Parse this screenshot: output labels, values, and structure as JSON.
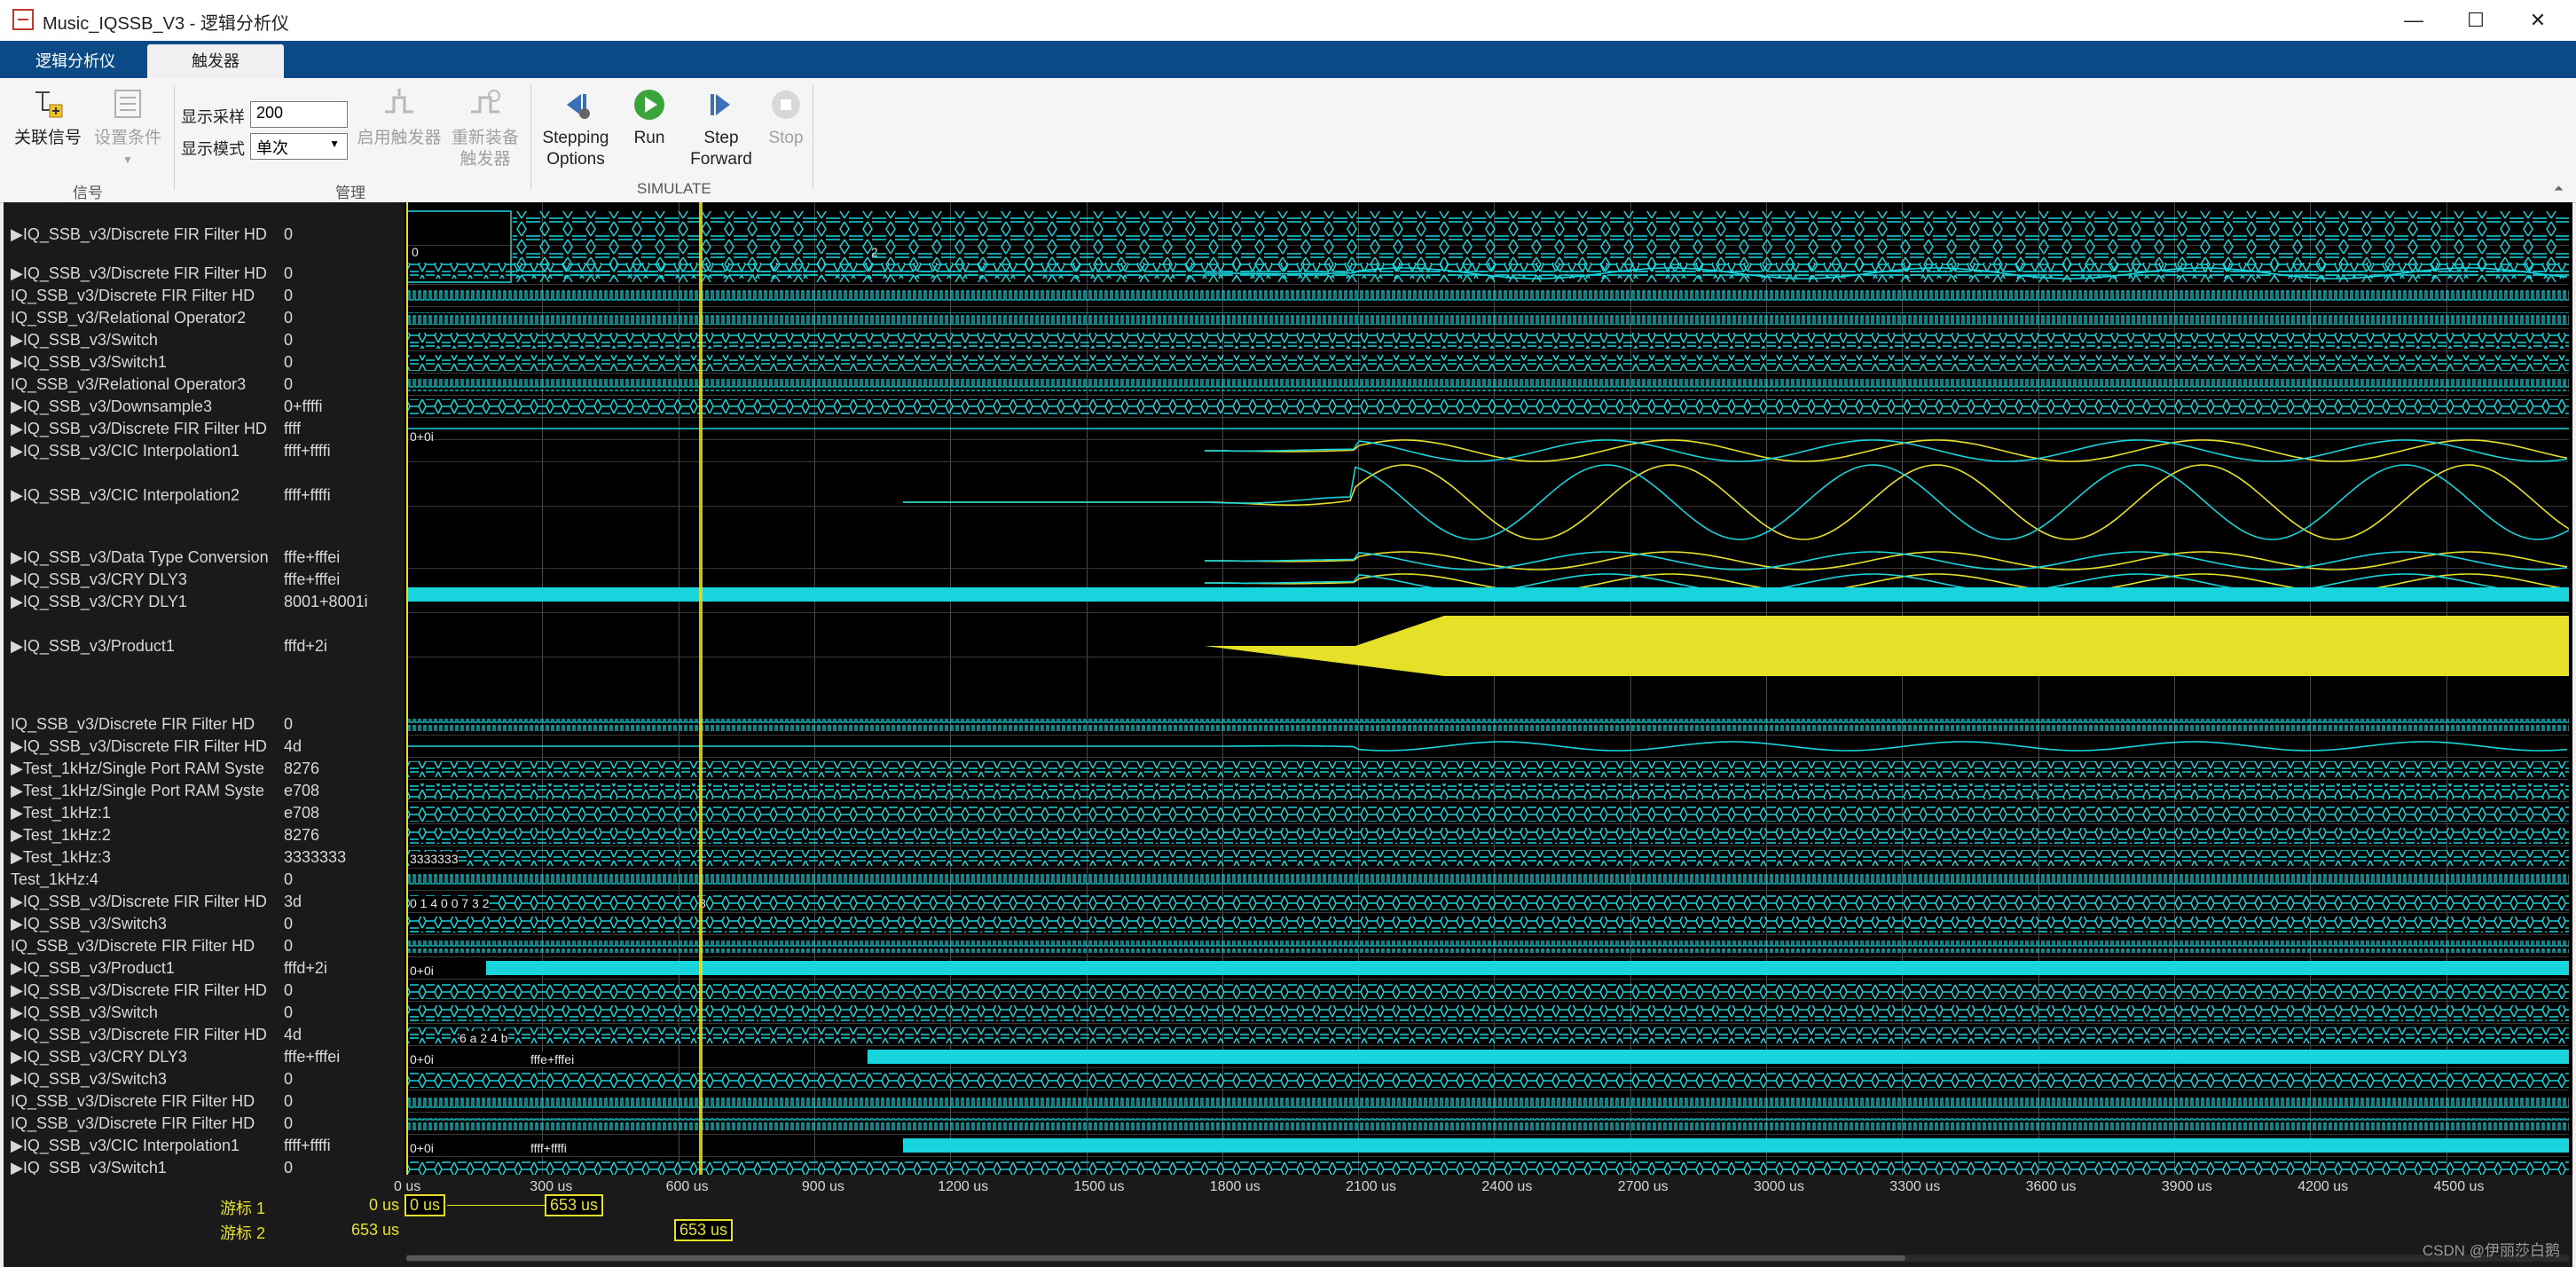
{
  "window": {
    "title": "Music_IQSSB_V3 - 逻辑分析仪",
    "minimize": "—",
    "maximize": "☐",
    "close": "✕"
  },
  "tabs": [
    {
      "label": "逻辑分析仪"
    },
    {
      "label": "触发器"
    }
  ],
  "ribbon": {
    "associate_signal": "关联信号",
    "set_condition": "设置条件",
    "group_signal": "信号",
    "display_samples_label": "显示采样",
    "display_samples_value": "200",
    "display_mode_label": "显示模式",
    "display_mode_value": "单次",
    "enable_trigger": "启用触发器",
    "rearm_trigger_1": "重新装备",
    "rearm_trigger_2": "触发器",
    "group_manage": "管理",
    "stepping_1": "Stepping",
    "stepping_2": "Options",
    "run": "Run",
    "step_forward_1": "Step",
    "step_forward_2": "Forward",
    "stop": "Stop",
    "group_simulate": "SIMULATE"
  },
  "colors": {
    "cyan": "#18d4dc",
    "yellow": "#e7e028",
    "accent": "#0b4a86"
  },
  "signals": [
    {
      "name": "▶IQ_SSB_v3/Discrete FIR Filter HD",
      "value": "0"
    },
    {
      "name": "▶IQ_SSB_v3/Discrete FIR Filter HD",
      "value": "0"
    },
    {
      "name": "  IQ_SSB_v3/Discrete FIR Filter HD",
      "value": "0"
    },
    {
      "name": "  IQ_SSB_v3/Relational Operator2",
      "value": "0"
    },
    {
      "name": "▶IQ_SSB_v3/Switch",
      "value": "0"
    },
    {
      "name": "▶IQ_SSB_v3/Switch1",
      "value": "0"
    },
    {
      "name": "  IQ_SSB_v3/Relational Operator3",
      "value": "0"
    },
    {
      "name": "▶IQ_SSB_v3/Downsample3",
      "value": "0+ffffi"
    },
    {
      "name": "▶IQ_SSB_v3/Discrete FIR Filter HD",
      "value": "ffff"
    },
    {
      "name": "▶IQ_SSB_v3/CIC Interpolation1",
      "value": "ffff+ffffi"
    },
    {
      "name": "▶IQ_SSB_v3/CIC Interpolation2",
      "value": "ffff+ffffi"
    },
    {
      "name": "▶IQ_SSB_v3/Data Type Conversion",
      "value": "fffe+fffei"
    },
    {
      "name": "▶IQ_SSB_v3/CRY DLY3",
      "value": "fffe+fffei"
    },
    {
      "name": "▶IQ_SSB_v3/CRY DLY1",
      "value": "8001+8001i"
    },
    {
      "name": "▶IQ_SSB_v3/Product1",
      "value": "fffd+2i"
    },
    {
      "name": "  IQ_SSB_v3/Discrete FIR Filter HD",
      "value": "0"
    },
    {
      "name": "▶IQ_SSB_v3/Discrete FIR Filter HD",
      "value": "4d"
    },
    {
      "name": "▶Test_1kHz/Single Port RAM Syste",
      "value": "8276"
    },
    {
      "name": "▶Test_1kHz/Single Port RAM Syste",
      "value": "e708"
    },
    {
      "name": "▶Test_1kHz:1",
      "value": "e708"
    },
    {
      "name": "▶Test_1kHz:2",
      "value": "8276"
    },
    {
      "name": "▶Test_1kHz:3",
      "value": "3333333"
    },
    {
      "name": "  Test_1kHz:4",
      "value": "0"
    },
    {
      "name": "▶IQ_SSB_v3/Discrete FIR Filter HD",
      "value": "3d"
    },
    {
      "name": "▶IQ_SSB_v3/Switch3",
      "value": "0"
    },
    {
      "name": "  IQ_SSB_v3/Discrete FIR Filter HD",
      "value": "0"
    },
    {
      "name": "▶IQ_SSB_v3/Product1",
      "value": "fffd+2i"
    },
    {
      "name": "▶IQ_SSB_v3/Discrete FIR Filter HD",
      "value": "0"
    },
    {
      "name": "▶IQ_SSB_v3/Switch",
      "value": "0"
    },
    {
      "name": "▶IQ_SSB_v3/Discrete FIR Filter HD",
      "value": "4d"
    },
    {
      "name": "▶IQ_SSB_v3/CRY DLY3",
      "value": "fffe+fffei"
    },
    {
      "name": "▶IQ_SSB_v3/Switch3",
      "value": "0"
    },
    {
      "name": "  IQ_SSB_v3/Discrete FIR Filter HD",
      "value": "0"
    },
    {
      "name": "  IQ_SSB_v3/Discrete FIR Filter HD",
      "value": "0"
    },
    {
      "name": "▶IQ_SSB_v3/CIC Interpolation1",
      "value": "ffff+ffffi"
    },
    {
      "name": "▶IQ_SSB_v3/Switch1",
      "value": "0"
    }
  ],
  "wave_text": {
    "zero": "0",
    "two": "2",
    "zero_i": "0+0i",
    "eight": "8",
    "test3": "3333333",
    "fffe": "fffe+fffei",
    "ffff": "ffff+ffffi",
    "seq1": "0 1 4 0 0 7 3 2",
    "seq2": "6 a 2 4 b"
  },
  "axis": {
    "ticks": [
      "0 us",
      "300 us",
      "600 us",
      "900 us",
      "1200 us",
      "1500 us",
      "1800 us",
      "2100 us",
      "2400 us",
      "2700 us",
      "3000 us",
      "3300 us",
      "3600 us",
      "3900 us",
      "4200 us",
      "4500 us"
    ]
  },
  "cursors": {
    "cursor1_label": "游标 1",
    "cursor1_value": "0 us",
    "cursor1_box": "0 us",
    "cursor1_box2": "653 us",
    "cursor2_label": "游标 2",
    "cursor2_value": "653 us",
    "cursor2_box": "653 us"
  },
  "watermark": "CSDN @伊丽莎白鹅"
}
